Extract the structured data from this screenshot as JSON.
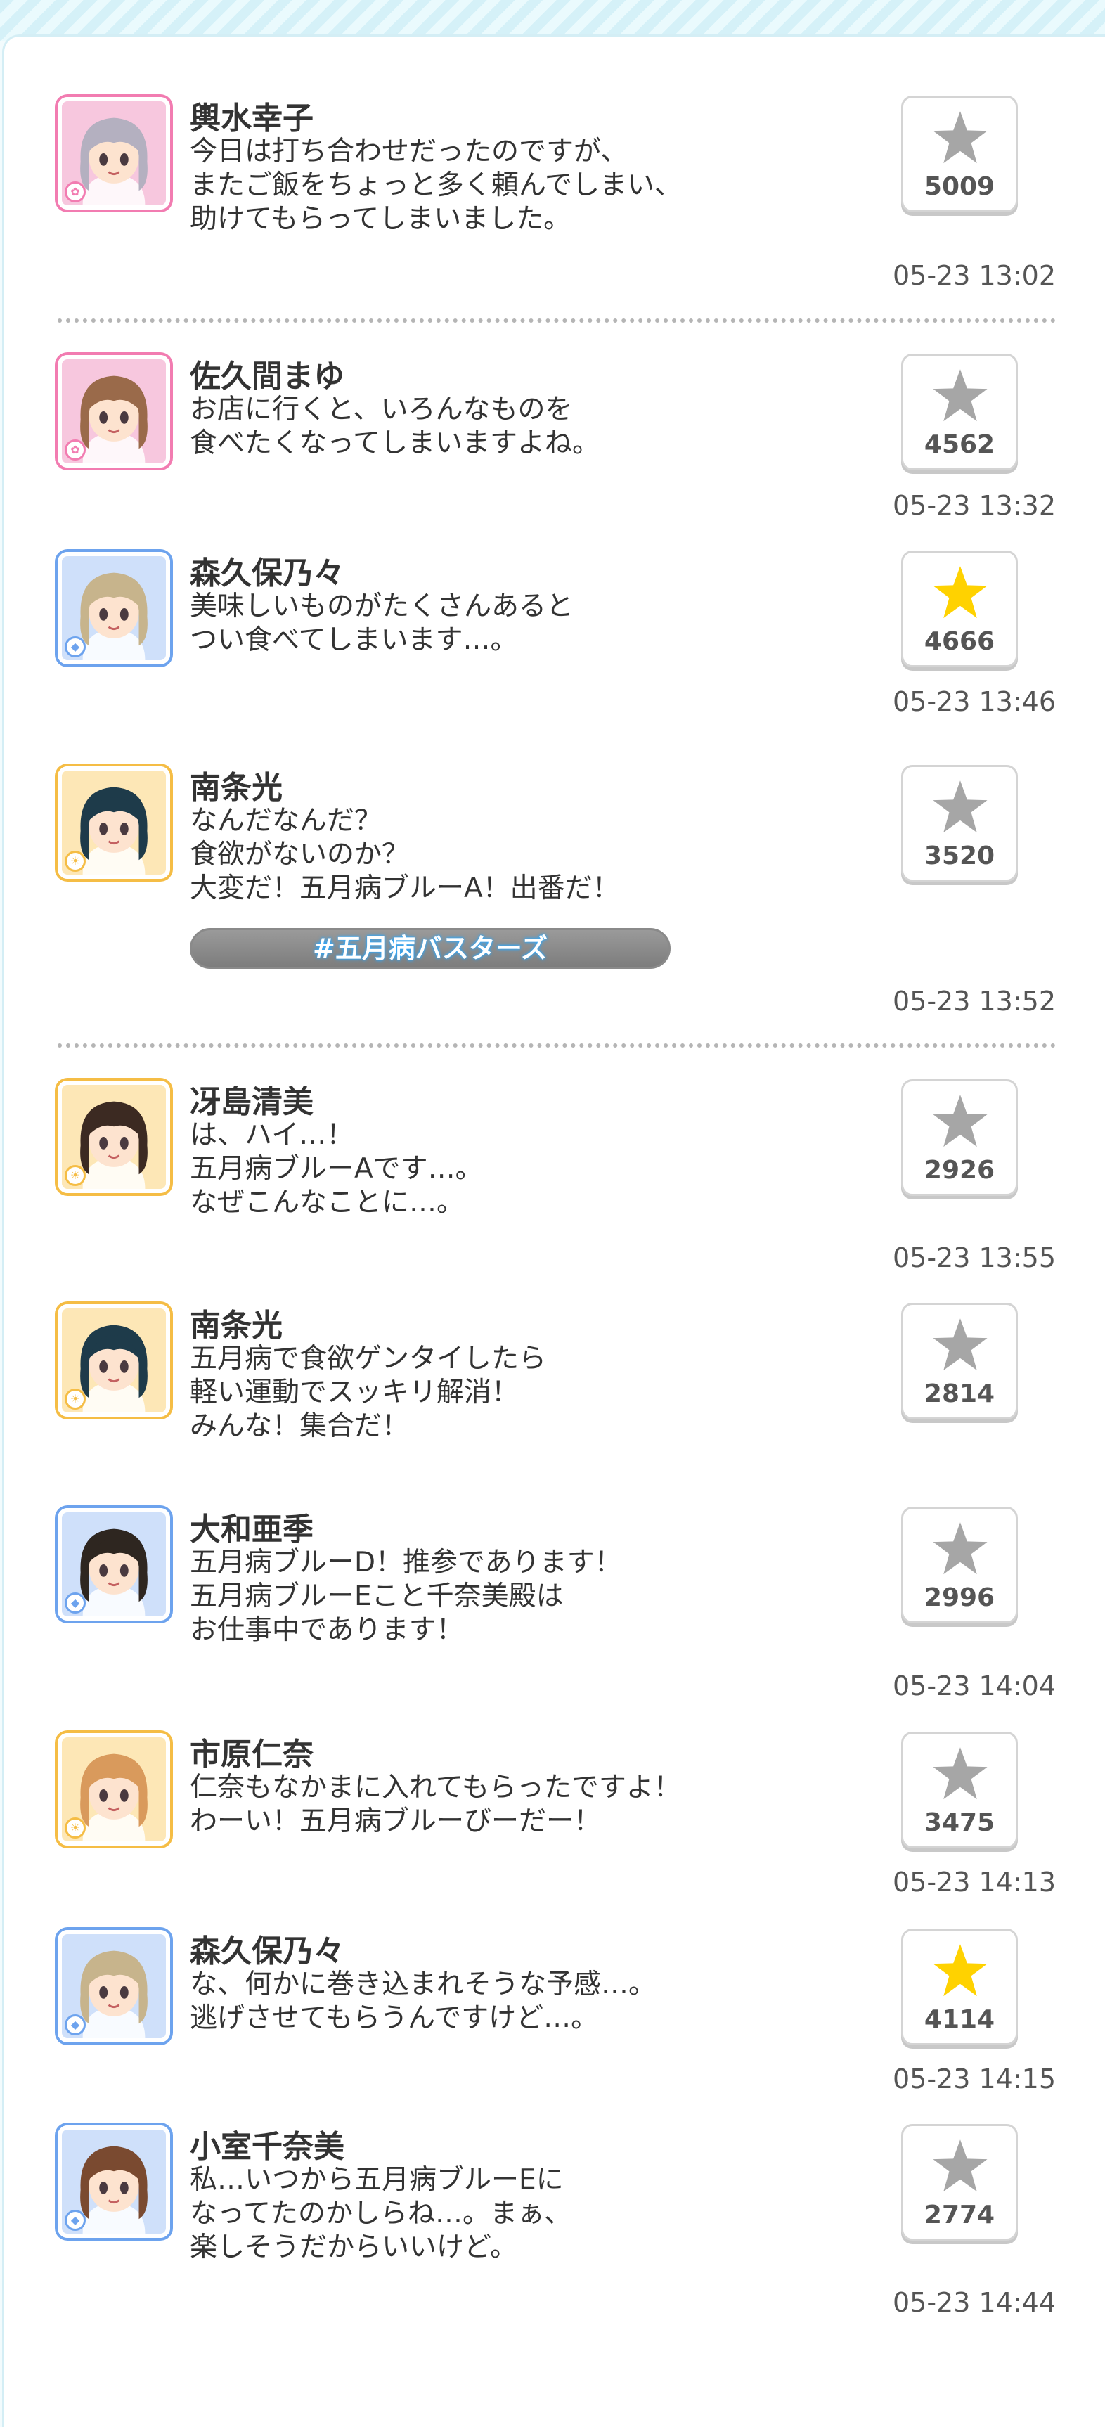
{
  "posts": [
    {
      "name": "輿水幸子",
      "lines": [
        "今日は打ち合わせだったのですが、",
        "またご飯をちょっと多く頼んでしまい、",
        "助けてもらってしまいました。"
      ],
      "stars": "5009",
      "time": "05-23 13:02",
      "type": "cute",
      "starred": false,
      "hair": "#b4b0c0",
      "bg": "#f7c7de"
    },
    {
      "name": "佐久間まゆ",
      "lines": [
        "お店に行くと、いろんなものを",
        "食べたくなってしまいますよね。"
      ],
      "stars": "4562",
      "time": "05-23 13:32",
      "type": "cute",
      "starred": false,
      "hair": "#9a6a4a",
      "bg": "#f7c7de"
    },
    {
      "name": "森久保乃々",
      "lines": [
        "美味しいものがたくさんあると",
        "つい食べてしまいます…。"
      ],
      "stars": "4666",
      "time": "05-23 13:46",
      "type": "cool",
      "starred": true,
      "hair": "#c7b48c",
      "bg": "#cfe0fa"
    },
    {
      "name": "南条光",
      "lines": [
        "なんだなんだ？",
        "食欲がないのか？",
        "大変だ！五月病ブルーA！出番だ！"
      ],
      "stars": "3520",
      "time": "05-23 13:52",
      "type": "passion",
      "starred": false,
      "hair": "#1e3b4a",
      "bg": "#fde7b6",
      "tag": "#五月病バスターズ"
    },
    {
      "name": "冴島清美",
      "lines": [
        "は、ハイ…！",
        "五月病ブルーAです…。",
        "なぜこんなことに…。"
      ],
      "stars": "2926",
      "time": "05-23 13:55",
      "type": "passion",
      "starred": false,
      "hair": "#3c2a22",
      "bg": "#fde7b6"
    },
    {
      "name": "南条光",
      "lines": [
        "五月病で食欲ゲンタイしたら",
        "軽い運動でスッキリ解消！",
        "みんな！集合だ！"
      ],
      "stars": "2814",
      "time": "",
      "type": "passion",
      "starred": false,
      "hair": "#1e3b4a",
      "bg": "#fde7b6"
    },
    {
      "name": "大和亜季",
      "lines": [
        "五月病ブルーD！推参であります！",
        "五月病ブルーEこと千奈美殿は",
        "お仕事中であります！"
      ],
      "stars": "2996",
      "time": "05-23 14:04",
      "type": "cool",
      "starred": false,
      "hair": "#2e2620",
      "bg": "#cfe0fa"
    },
    {
      "name": "市原仁奈",
      "lines": [
        "仁奈もなかまに入れてもらったですよ！",
        "わーい！五月病ブルーびーだー！"
      ],
      "stars": "3475",
      "time": "05-23 14:13",
      "type": "passion",
      "starred": false,
      "hair": "#d99a5c",
      "bg": "#fde7b6"
    },
    {
      "name": "森久保乃々",
      "lines": [
        "な、何かに巻き込まれそうな予感…。",
        "逃げさせてもらうんですけど…。"
      ],
      "stars": "4114",
      "time": "05-23 14:15",
      "type": "cool",
      "starred": true,
      "hair": "#c7b48c",
      "bg": "#cfe0fa"
    },
    {
      "name": "小室千奈美",
      "lines": [
        "私…いつから五月病ブルーEに",
        "なってたのかしらね…。まぁ、",
        "楽しそうだからいいけど。"
      ],
      "stars": "2774",
      "time": "05-23 14:44",
      "type": "cool",
      "starred": false,
      "hair": "#7a4a30",
      "bg": "#cfe0fa"
    }
  ],
  "colors": {
    "star_on": "#ffd200",
    "star_off": "#a6a6a6",
    "cute": "#f27cb1",
    "cool": "#6da3ee",
    "passion": "#f5bd45"
  },
  "icons": {
    "badge_cute": "flower-icon",
    "badge_cool": "diamond-icon",
    "badge_passion": "sun-icon",
    "star": "star-icon"
  }
}
